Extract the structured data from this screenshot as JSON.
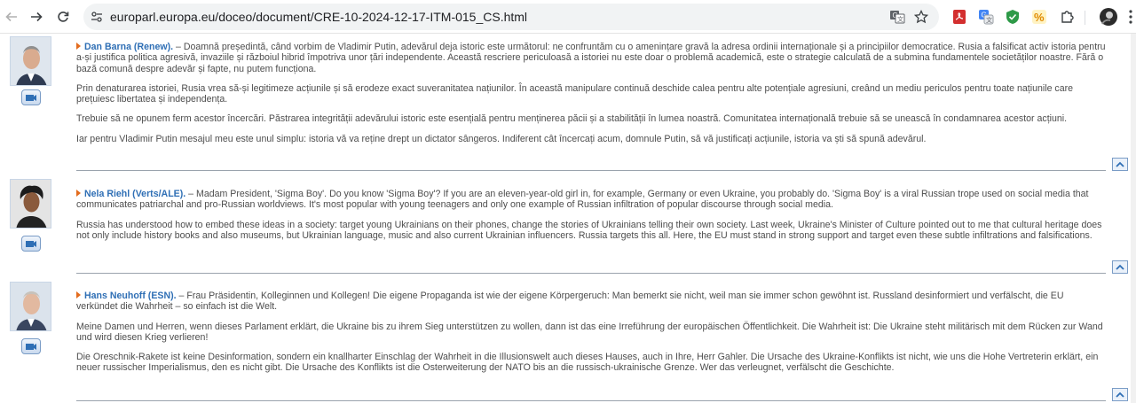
{
  "browser": {
    "url": "europarl.europa.eu/doceo/document/CRE-10-2024-12-17-ITM-015_CS.html",
    "icons": {
      "back": "arrow-left-icon",
      "forward": "arrow-right-icon",
      "reload": "reload-icon",
      "site": "site-info-icon",
      "translate": "translate-icon",
      "bookmark": "star-icon",
      "extensions": [
        "pdf-extension-icon",
        "translate-extension-icon",
        "shield-extension-icon",
        "coupon-extension-icon",
        "puzzle-extensions-icon"
      ],
      "profile": "profile-avatar",
      "menu": "kebab-menu-icon"
    }
  },
  "speeches": [
    {
      "speaker": "Dan Barna (Renew).",
      "paragraphs": [
        " – Doamnă președintă, când vorbim de Vladimir Putin, adevărul deja istoric este următorul: ne confruntăm cu o amenințare gravă la adresa ordinii internaționale și a principiilor democratice. Rusia a falsificat activ istoria pentru a-și justifica politica agresivă, invaziile și războiul hibrid împotriva unor țări independente. Această rescriere periculoasă a istoriei nu este doar o problemă academică, este o strategie calculată de a submina fundamentele societăților noastre. Fără o bază comună despre adevăr și fapte, nu putem funcționa.",
        "Prin denaturarea istoriei, Rusia vrea să-și legitimeze acțiunile și să erodeze exact suveranitatea națiunilor. În această manipulare continuă deschide calea pentru alte potențiale agresiuni, creând un mediu periculos pentru toate națiunile care prețuiesc libertatea și independența.",
        "Trebuie să ne opunem ferm acestor încercări. Păstrarea integrității adevărului istoric este esențială pentru menținerea păcii și a stabilității în lumea noastră. Comunitatea internațională trebuie să se unească în condamnarea acestor acțiuni.",
        "Iar pentru Vladimir Putin mesajul meu este unul simplu: istoria vă va reține drept un dictator sângeros. Indiferent cât încercați acum, domnule Putin, să vă justificați acțiunile, istoria va ști să spună adevărul."
      ]
    },
    {
      "speaker": "Nela Riehl (Verts/ALE).",
      "paragraphs": [
        " – Madam President, 'Sigma Boy'. Do you know 'Sigma Boy'? If you are an eleven-year-old girl in, for example, Germany or even Ukraine, you probably do. 'Sigma Boy' is a viral Russian trope used on social media that communicates patriarchal and pro-Russian worldviews. It's most popular with young teenagers and only one example of Russian infiltration of popular discourse through social media.",
        "Russia has understood how to embed these ideas in a society: target young Ukrainians on their phones, change the stories of Ukrainians telling their own society. Last week, Ukraine's Minister of Culture pointed out to me that cultural heritage does not only include history books and also museums, but Ukrainian language, music and also current Ukrainian influencers. Russia targets this all. Here, the EU must stand in strong support and target even these subtle infiltrations and falsifications."
      ]
    },
    {
      "speaker": "Hans Neuhoff (ESN).",
      "paragraphs": [
        " – Frau Präsidentin, Kolleginnen und Kollegen! Die eigene Propaganda ist wie der eigene Körpergeruch: Man bemerkt sie nicht, weil man sie immer schon gewöhnt ist. Russland desinformiert und verfälscht, die EU verkündet die Wahrheit – so einfach ist die Welt.",
        "Meine Damen und Herren, wenn dieses Parlament erklärt, die Ukraine bis zu ihrem Sieg unterstützen zu wollen, dann ist das eine Irreführung der europäischen Öffentlichkeit. Die Wahrheit ist: Die Ukraine steht militärisch mit dem Rücken zur Wand und wird diesen Krieg verlieren!",
        "Die Oreschnik-Rakete ist keine Desinformation, sondern ein knallharter Einschlag der Wahrheit in die Illusionswelt auch dieses Hauses, auch in Ihre, Herr Gahler. Die Ursache des Ukraine-Konflikts ist nicht, wie uns die Hohe Vertreterin erklärt, ein neuer russischer Imperialismus, den es nicht gibt. Die Ursache des Konflikts ist die Osterweiterung der NATO bis an die russisch-ukrainische Grenze. Wer das verleugnet, verfälscht die Geschichte."
      ]
    }
  ]
}
